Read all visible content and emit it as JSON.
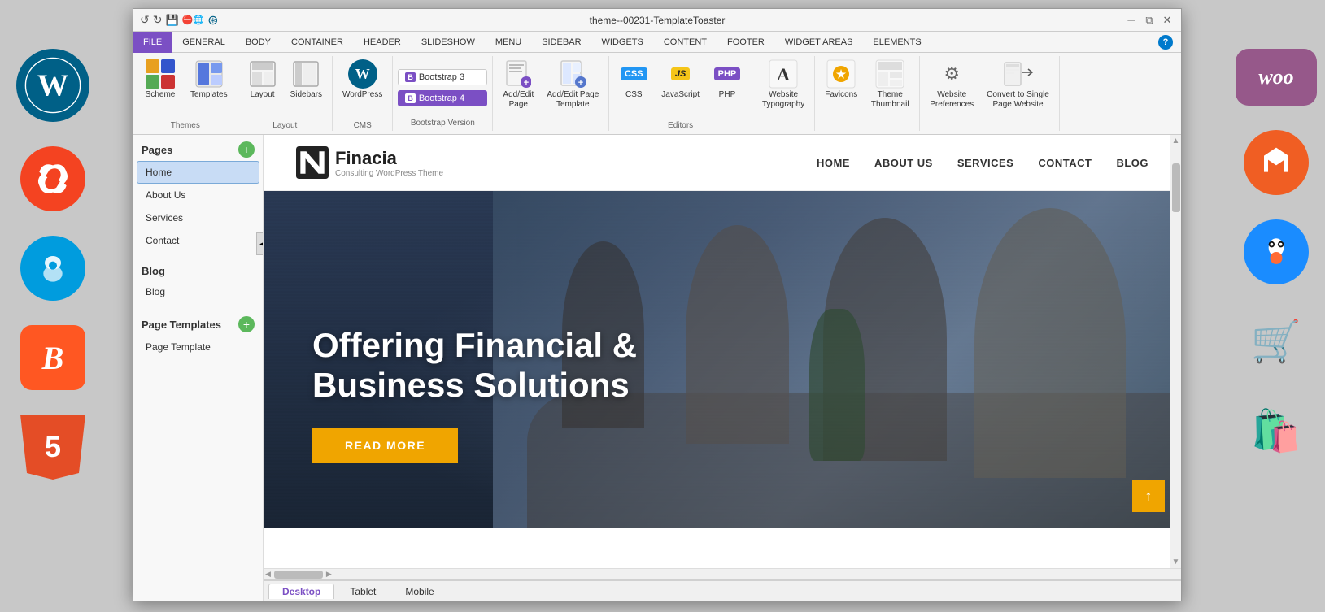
{
  "window": {
    "title": "theme--00231-TemplateToaster",
    "tabs": {
      "file": "FILE",
      "general": "GENERAL",
      "body": "BODY",
      "container": "CONTAINER",
      "header": "HEADER",
      "slideshow": "SLIDESHOW",
      "menu": "MENU",
      "sidebar": "SIDEBAR",
      "widgets": "WIDGETS",
      "content": "CONTENT",
      "footer": "FOOTER",
      "widget_areas": "WIDGET AREAS",
      "elements": "ELEMENTS"
    }
  },
  "ribbon": {
    "themes_group": "Themes",
    "layout_group": "Layout",
    "cms_group": "CMS",
    "bootstrap_group": "Bootstrap Version",
    "editors_group": "Editors",
    "buttons": {
      "scheme": "Scheme",
      "templates": "Templates",
      "layout": "Layout",
      "sidebars": "Sidebars",
      "wordpress": "WordPress",
      "bootstrap3": "Bootstrap 3",
      "bootstrap4": "Bootstrap 4",
      "add_edit_page": "Add/Edit\nPage",
      "add_edit_page_template": "Add/Edit Page\nTemplate",
      "css": "CSS",
      "javascript": "JavaScript",
      "php": "PHP",
      "website_typography": "Website\nTypography",
      "favicons": "Favicons",
      "theme_thumbnail": "Theme\nThumbnail",
      "website_preferences": "Website\nPreferences",
      "convert": "Convert to Single\nPage Website"
    }
  },
  "sidebar": {
    "pages_title": "Pages",
    "pages_items": [
      "Home",
      "About Us",
      "Services",
      "Contact"
    ],
    "blog_title": "Blog",
    "blog_items": [
      "Blog"
    ],
    "page_templates_title": "Page Templates",
    "page_template_items": [
      "Page Template"
    ]
  },
  "website": {
    "logo_name": "Finacia",
    "logo_tagline": "Consulting WordPress Theme",
    "nav_items": [
      "HOME",
      "ABOUT US",
      "SERVICES",
      "CONTACT",
      "BLOG"
    ],
    "hero_title": "Offering Financial & Business Solutions",
    "hero_button": "READ MORE"
  },
  "bottom_tabs": [
    "Desktop",
    "Tablet",
    "Mobile"
  ],
  "platform_icons": {
    "left": [
      "wordpress",
      "joomla",
      "drupal",
      "blogger",
      "html5"
    ],
    "right": [
      "woo",
      "magento",
      "puffin",
      "opencart",
      "cart"
    ]
  }
}
